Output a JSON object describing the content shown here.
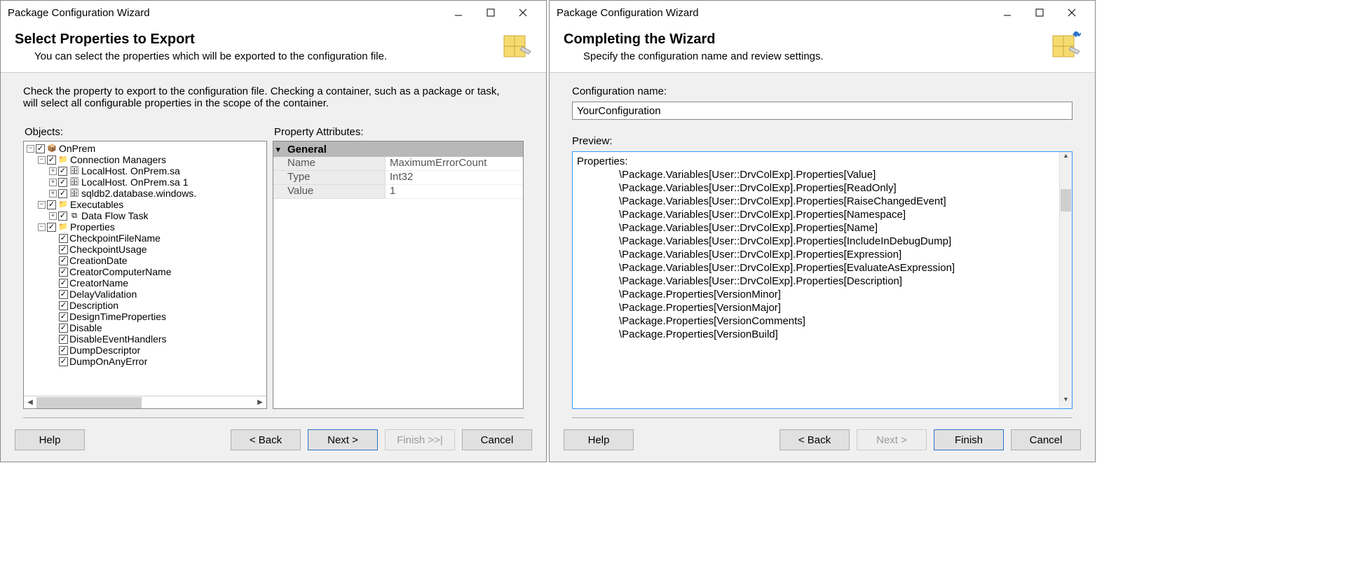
{
  "left": {
    "title": "Package Configuration Wizard",
    "heading": "Select Properties to Export",
    "subheading": "You can select the properties which will be exported to the configuration file.",
    "instructions": "Check the property to export to the configuration file. Checking a container, such as a package or task, will select all configurable properties in the scope of the container.",
    "labels": {
      "objects": "Objects:",
      "attributes": "Property Attributes:"
    },
    "tree": {
      "root": "OnPrem",
      "cm": "Connection Managers",
      "cm1": "LocalHost.                 OnPrem.sa",
      "cm2": "LocalHost.                 OnPrem.sa 1",
      "cm3": "              sqldb2.database.windows.",
      "exec": "Executables",
      "dft": "Data Flow Task",
      "props": "Properties",
      "p": [
        "CheckpointFileName",
        "CheckpointUsage",
        "CreationDate",
        "CreatorComputerName",
        "CreatorName",
        "DelayValidation",
        "Description",
        "DesignTimeProperties",
        "Disable",
        "DisableEventHandlers",
        "DumpDescriptor",
        "DumpOnAnyError"
      ]
    },
    "attr": {
      "section": "General",
      "rows": [
        {
          "k": "Name",
          "v": "MaximumErrorCount"
        },
        {
          "k": "Type",
          "v": "Int32"
        },
        {
          "k": "Value",
          "v": "1"
        }
      ]
    },
    "buttons": {
      "help": "Help",
      "back": "< Back",
      "next": "Next >",
      "finish": "Finish >>|",
      "cancel": "Cancel"
    }
  },
  "right": {
    "title": "Package Configuration Wizard",
    "heading": "Completing the Wizard",
    "subheading": "Specify the configuration name and review settings.",
    "labels": {
      "configName": "Configuration name:",
      "preview": "Preview:"
    },
    "configName": "YourConfiguration",
    "preview": {
      "header": "Properties:",
      "lines": [
        "\\Package.Variables[User::DrvColExp].Properties[Value]",
        "\\Package.Variables[User::DrvColExp].Properties[ReadOnly]",
        "\\Package.Variables[User::DrvColExp].Properties[RaiseChangedEvent]",
        "\\Package.Variables[User::DrvColExp].Properties[Namespace]",
        "\\Package.Variables[User::DrvColExp].Properties[Name]",
        "\\Package.Variables[User::DrvColExp].Properties[IncludeInDebugDump]",
        "\\Package.Variables[User::DrvColExp].Properties[Expression]",
        "\\Package.Variables[User::DrvColExp].Properties[EvaluateAsExpression]",
        "\\Package.Variables[User::DrvColExp].Properties[Description]",
        "\\Package.Properties[VersionMinor]",
        "\\Package.Properties[VersionMajor]",
        "\\Package.Properties[VersionComments]",
        "\\Package.Properties[VersionBuild]"
      ]
    },
    "buttons": {
      "help": "Help",
      "back": "< Back",
      "next": "Next >",
      "finish": "Finish",
      "cancel": "Cancel"
    }
  }
}
